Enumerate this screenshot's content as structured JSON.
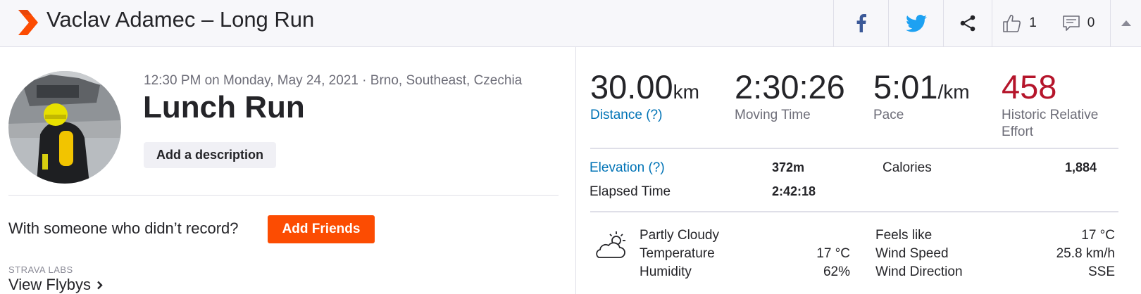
{
  "header": {
    "title": "Vaclav Adamec – Long Run",
    "kudos_count": "1",
    "comment_count": "0",
    "colors": {
      "brand": "#fc4c02",
      "facebook": "#3b5998",
      "twitter": "#1da1f2"
    },
    "icons": [
      "strava-chevron-icon",
      "facebook-icon",
      "twitter-icon",
      "share-icon",
      "thumbs-up-icon",
      "comment-icon",
      "collapse-caret-icon"
    ]
  },
  "activity": {
    "meta": "12:30 PM on Monday, May 24, 2021 · Brno, Southeast, Czechia",
    "name": "Lunch Run",
    "add_description": "Add a description",
    "with_someone": "With someone who didn’t record?",
    "add_friends": "Add Friends",
    "labs_label": "STRAVA LABS",
    "view_flybys": "View Flybys"
  },
  "stats": {
    "distance": {
      "value": "30.00",
      "unit": "km",
      "label": "Distance (?)"
    },
    "moving_time": {
      "value": "2:30:26",
      "label": "Moving Time"
    },
    "pace": {
      "value": "5:01",
      "unit": "/km",
      "label": "Pace"
    },
    "relative_effort": {
      "value": "458",
      "label_line1": "Historic Relative",
      "label_line2": "Effort",
      "color": "#b5152b"
    }
  },
  "details": {
    "elevation_label": "Elevation (?)",
    "elevation_value": "372m",
    "calories_label": "Calories",
    "calories_value": "1,884",
    "elapsed_label": "Elapsed Time",
    "elapsed_value": "2:42:18"
  },
  "weather": {
    "icon": "partly-cloudy-icon",
    "condition": "Partly Cloudy",
    "temperature_label": "Temperature",
    "temperature_value": "17 °C",
    "humidity_label": "Humidity",
    "humidity_value": "62%",
    "feels_like_label": "Feels like",
    "feels_like_value": "17 °C",
    "wind_speed_label": "Wind Speed",
    "wind_speed_value": "25.8 km/h",
    "wind_direction_label": "Wind Direction",
    "wind_direction_value": "SSE"
  }
}
